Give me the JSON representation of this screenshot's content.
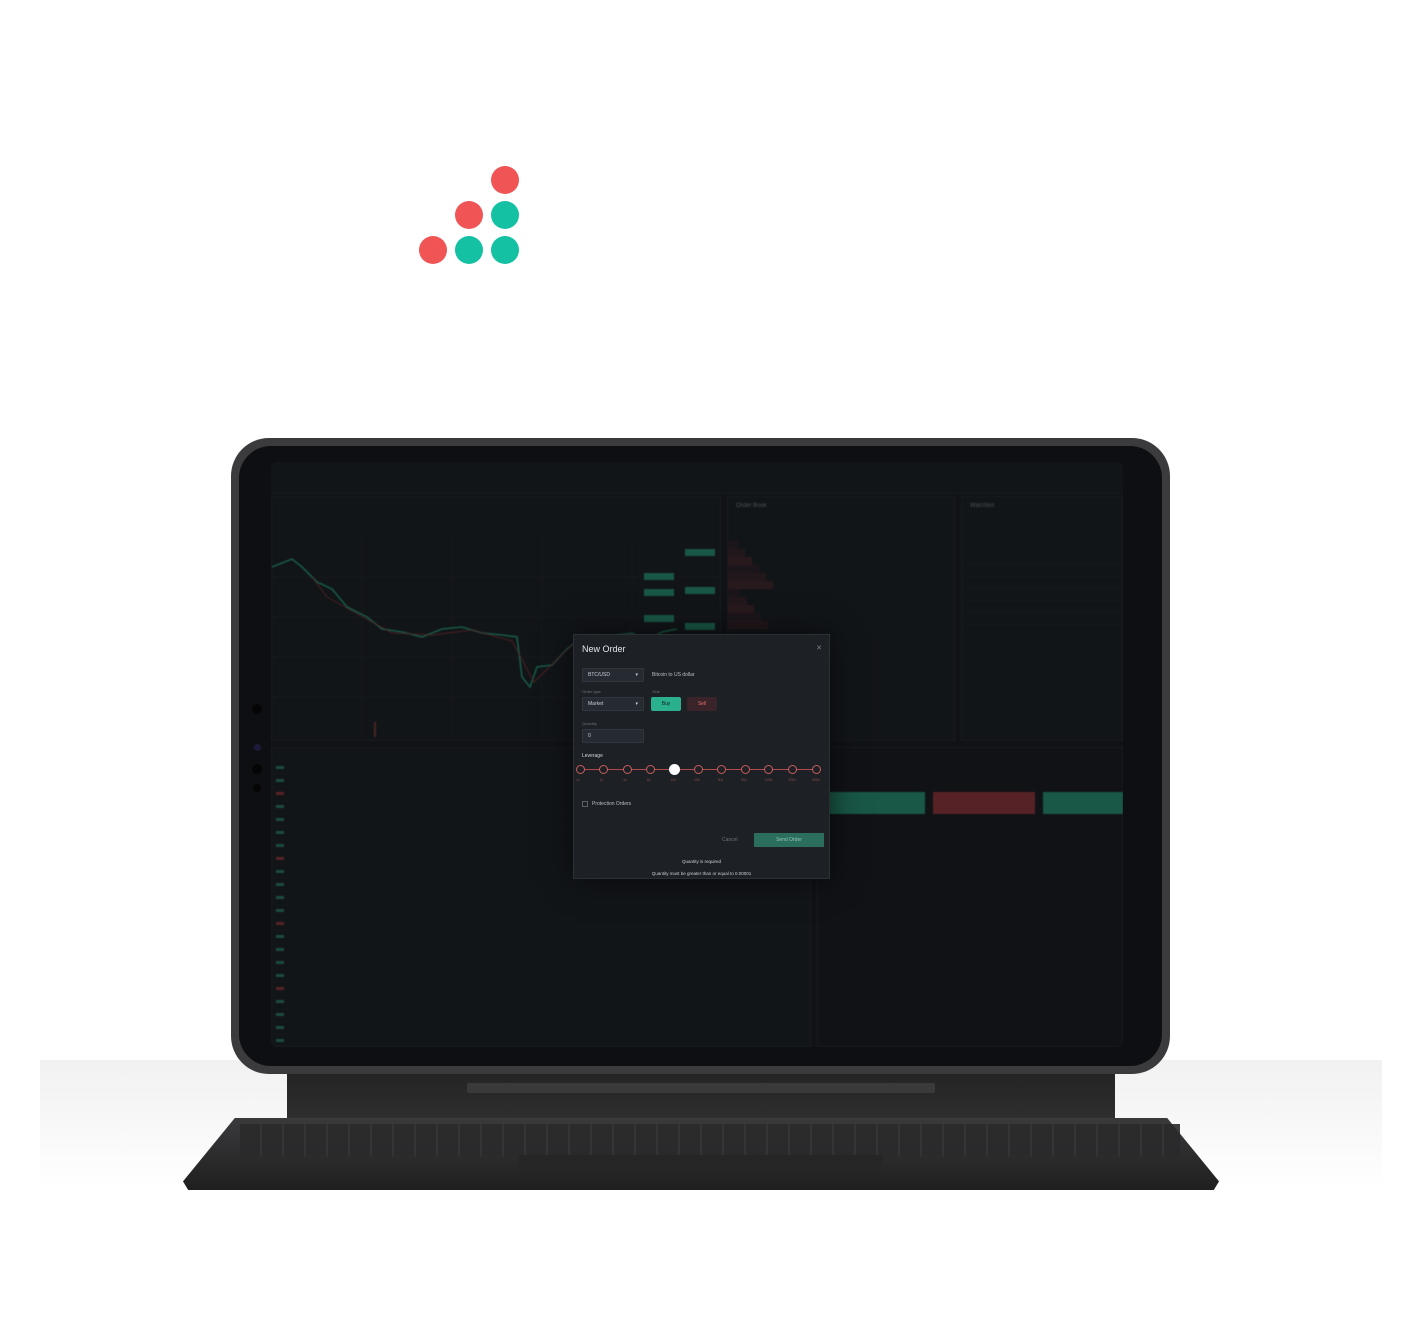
{
  "logo": {
    "colors": {
      "red": "#f05454",
      "green": "#15c1a3"
    }
  },
  "screen": {
    "order_book_title": "Order Book",
    "markets_title": "Watchlist"
  },
  "new_order": {
    "title": "New Order",
    "close_icon": "close-icon",
    "symbol": "BTC/USD",
    "symbol_name": "Bitcoin to US dollar",
    "order_type_label": "Order type",
    "order_type_value": "Market",
    "side_label": "Side",
    "buy_label": "Buy",
    "sell_label": "Sell",
    "quantity_label": "Quantity",
    "quantity_value": "0",
    "leverage_label": "Leverage",
    "leverage_steps": [
      "1x",
      "2x",
      "3x",
      "5x",
      "10x",
      "20x",
      "30x",
      "50x",
      "100x",
      "200x",
      "500x"
    ],
    "leverage_selected": "10x",
    "protection_label": "Protection Orders",
    "cancel_label": "Cancel",
    "send_label": "Send Order",
    "errors": [
      "Quantity is required",
      "Quantity must be greater than or equal to 0.00001"
    ]
  }
}
